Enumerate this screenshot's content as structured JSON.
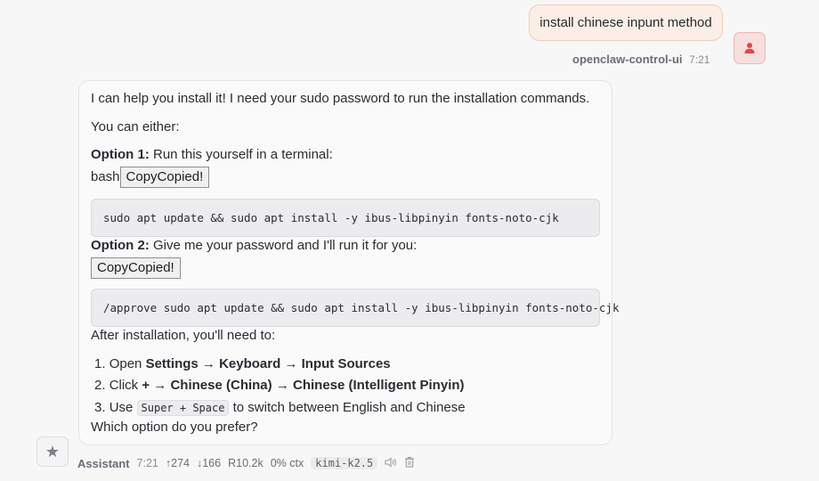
{
  "user_message": {
    "text": "install chinese inpunt method",
    "sender": "openclaw-control-ui",
    "time": "7:21"
  },
  "assistant_message": {
    "intro": "I can help you install it! I need your sudo password to run the installation commands.",
    "either": "You can either:",
    "option1_label": "Option 1:",
    "option1_text": " Run this yourself in a terminal:",
    "code1_lang": "bash",
    "copy_label": "CopyCopied!",
    "code1": "sudo apt update && sudo apt install -y ibus-libpinyin fonts-noto-cjk",
    "option2_label": "Option 2:",
    "option2_text": " Give me your password and I'll run it for you:",
    "code2": "/approve sudo apt update && sudo apt install -y ibus-libpinyin fonts-noto-cjk",
    "after": "After installation, you'll need to:",
    "steps": [
      {
        "num": "1.",
        "pre": "Open ",
        "b1": "Settings",
        "a1": " → ",
        "b2": "Keyboard",
        "a2": " → ",
        "b3": "Input Sources"
      },
      {
        "num": "2.",
        "pre": "Click ",
        "b1": "+",
        "a1": " → ",
        "b2": "Chinese (China)",
        "a2": " → ",
        "b3": "Chinese (Intelligent Pinyin)"
      },
      {
        "num": "3.",
        "pre": "Use ",
        "kbd": "Super + Space",
        "post": " to switch between English and Chinese"
      }
    ],
    "question": "Which option do you prefer?"
  },
  "footer": {
    "name": "Assistant",
    "time": "7:21",
    "tokens_up": "↑274",
    "tokens_down": "↓166",
    "cache": "R10.2k",
    "ctx": "0% ctx",
    "model": "kimi-k2.5"
  },
  "icons": {
    "user_avatar": "person-icon",
    "assistant_avatar": "star-icon",
    "speaker": "speaker-icon",
    "delete": "trash-icon"
  },
  "colors": {
    "user_bubble_bg": "#fbeee6",
    "user_avatar_accent": "#e04848",
    "page_bg": "#f7f7f8"
  }
}
